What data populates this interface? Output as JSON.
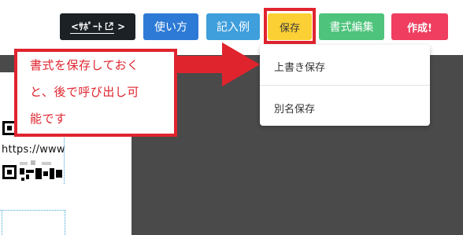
{
  "toolbar": {
    "support_label": "<ｻﾎﾟｰﾄ",
    "support_suffix": ">",
    "usage_label": "使い方",
    "example_label": "記入例",
    "save_label": "保存",
    "format_edit_label": "書式編集",
    "create_label": "作成!"
  },
  "dropdown": {
    "overwrite_label": "上書き保存",
    "saveas_label": "別名保存"
  },
  "callout": {
    "line1": "書式を保存しておく",
    "line2": "と、後で呼び出し可",
    "line3": "能です"
  },
  "document": {
    "qr_url_text": "https://www"
  },
  "colors": {
    "dark_background": "#4a4a4a",
    "support_button": "#1b2125",
    "usage_button": "#2d7ad6",
    "example_button": "#3f9edc",
    "save_button": "#fbd035",
    "format_edit_button": "#4dc37b",
    "create_button": "#ef3e5f",
    "annotation_red": "#e0242e"
  },
  "icons": {
    "support_external": "external-link-icon",
    "annotation_arrow": "arrow-right-icon"
  }
}
